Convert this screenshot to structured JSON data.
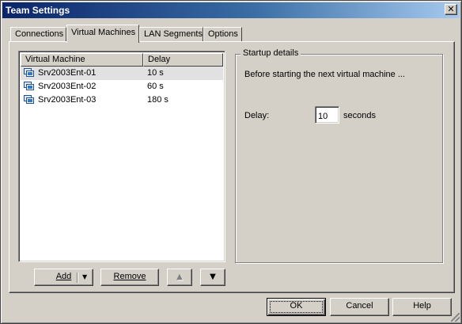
{
  "window": {
    "title": "Team Settings",
    "close_label": "✕"
  },
  "tabs": [
    {
      "label": "Connections",
      "active": false
    },
    {
      "label": "Virtual Machines",
      "active": true
    },
    {
      "label": "LAN Segments",
      "active": false
    },
    {
      "label": "Options",
      "active": false
    }
  ],
  "vm_list": {
    "columns": [
      "Virtual Machine",
      "Delay"
    ],
    "rows": [
      {
        "name": "Srv2003Ent-01",
        "delay": "10 s",
        "selected": true,
        "icon": "virtual-machine-icon"
      },
      {
        "name": "Srv2003Ent-02",
        "delay": "60 s",
        "selected": false,
        "icon": "virtual-machine-icon"
      },
      {
        "name": "Srv2003Ent-03",
        "delay": "180 s",
        "selected": false,
        "icon": "virtual-machine-icon"
      }
    ]
  },
  "startup_details": {
    "group_label": "Startup details",
    "description": "Before starting the next virtual machine ...",
    "delay_label": "Delay:",
    "delay_value": "10",
    "unit": "seconds"
  },
  "list_buttons": {
    "add": "Add",
    "remove": "Remove",
    "move_up_icon": "arrow-up-icon",
    "move_down_icon": "arrow-down-icon"
  },
  "dialog_buttons": {
    "ok": "OK",
    "cancel": "Cancel",
    "help": "Help"
  },
  "colors": {
    "titlebar_start": "#0a246a",
    "titlebar_end": "#a6caf0",
    "face": "#d4d0c8",
    "selected_row": "#e1e1e1"
  }
}
